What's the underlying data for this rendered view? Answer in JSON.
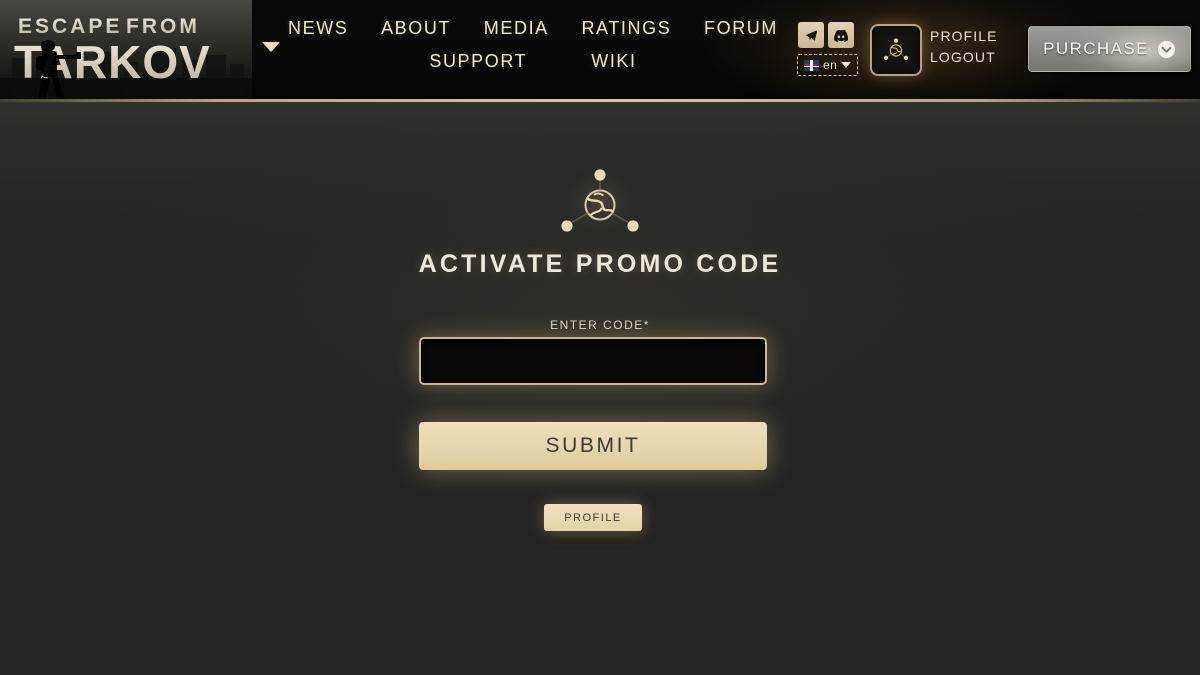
{
  "site": {
    "logo_line1": "ESCAPE FROM",
    "logo_line2": "TARKOV"
  },
  "header": {
    "nav_row1": [
      {
        "label": "NEWS",
        "name": "nav-news"
      },
      {
        "label": "ABOUT",
        "name": "nav-about"
      },
      {
        "label": "MEDIA",
        "name": "nav-media"
      },
      {
        "label": "RATINGS",
        "name": "nav-ratings"
      },
      {
        "label": "FORUM",
        "name": "nav-forum"
      }
    ],
    "nav_row2": [
      {
        "label": "SUPPORT",
        "name": "nav-support"
      },
      {
        "label": "WIKI",
        "name": "nav-wiki"
      }
    ],
    "social": [
      {
        "icon": "telegram-icon"
      },
      {
        "icon": "discord-icon"
      }
    ],
    "language": {
      "code": "en",
      "flag": "uk-flag-icon",
      "caret": "chevron-down-icon"
    },
    "avatar_icon": "globe-network-icon",
    "user_links": [
      {
        "label": "PROFILE",
        "name": "header-profile-link"
      },
      {
        "label": "LOGOUT",
        "name": "header-logout-link"
      }
    ],
    "purchase": {
      "label": "PURCHASE",
      "icon": "chevron-down-circle-icon"
    },
    "logo_caret_icon": "chevron-down-icon"
  },
  "main": {
    "hero_icon": "globe-network-icon",
    "title": "ACTIVATE PROMO CODE",
    "form": {
      "label": "ENTER CODE",
      "required_mark": "*",
      "input_value": "",
      "input_placeholder": "",
      "submit_label": "SUBMIT",
      "profile_label": "PROFILE"
    }
  },
  "colors": {
    "accent_gold": "#c9b88d",
    "button_cream": "#e6d5ac",
    "text_light": "#efe8d6",
    "header_black": "#0a0908",
    "body_dark": "#232322"
  }
}
